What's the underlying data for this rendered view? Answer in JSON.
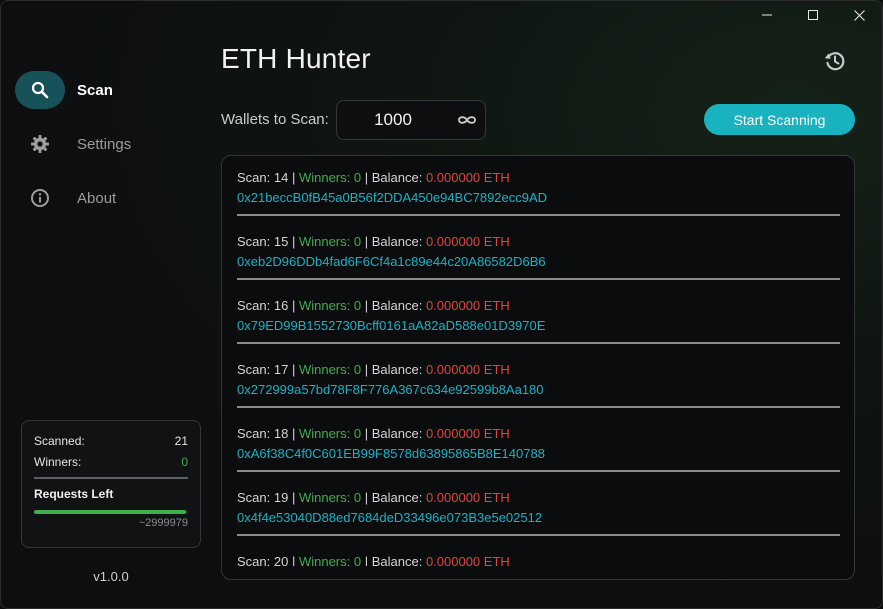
{
  "app": {
    "title": "ETH Hunter",
    "version": "v1.0.0"
  },
  "window_controls": {
    "minimize": "minimize-icon",
    "maximize": "maximize-icon",
    "close": "close-icon"
  },
  "sidebar": {
    "items": [
      {
        "label": "Scan",
        "icon": "search-icon",
        "active": true
      },
      {
        "label": "Settings",
        "icon": "gear-icon",
        "active": false
      },
      {
        "label": "About",
        "icon": "info-icon",
        "active": false
      }
    ]
  },
  "stats": {
    "scanned_label": "Scanned:",
    "scanned_value": "21",
    "winners_label": "Winners:",
    "winners_value": "0",
    "requests_label": "Requests Left",
    "requests_value": "~2999979",
    "requests_fraction": 0.99
  },
  "controls": {
    "wallets_label": "Wallets to Scan:",
    "wallets_value": "1000",
    "infinity_icon": "infinity-icon",
    "start_label": "Start Scanning",
    "history_icon": "history-icon"
  },
  "scans": [
    {
      "scan_label": "Scan:",
      "scan": "14",
      "winners_label": "Winners:",
      "winners": "0",
      "balance_label": "Balance:",
      "balance": "0.000000 ETH",
      "address": "0x21beccB0fB45a0B56f2DDA450e94BC7892ecc9AD"
    },
    {
      "scan_label": "Scan:",
      "scan": "15",
      "winners_label": "Winners:",
      "winners": "0",
      "balance_label": "Balance:",
      "balance": "0.000000 ETH",
      "address": "0xeb2D96DDb4fad6F6Cf4a1c89e44c20A86582D6B6"
    },
    {
      "scan_label": "Scan:",
      "scan": "16",
      "winners_label": "Winners:",
      "winners": "0",
      "balance_label": "Balance:",
      "balance": "0.000000 ETH",
      "address": "0x79ED99B1552730Bcff0161aA82aD588e01D3970E"
    },
    {
      "scan_label": "Scan:",
      "scan": "17",
      "winners_label": "Winners:",
      "winners": "0",
      "balance_label": "Balance:",
      "balance": "0.000000 ETH",
      "address": "0x272999a57bd78F8F776A367c634e92599b8Aa180"
    },
    {
      "scan_label": "Scan:",
      "scan": "18",
      "winners_label": "Winners:",
      "winners": "0",
      "balance_label": "Balance:",
      "balance": "0.000000 ETH",
      "address": "0xA6f38C4f0C601EB99F8578d63895865B8E140788"
    },
    {
      "scan_label": "Scan:",
      "scan": "19",
      "winners_label": "Winners:",
      "winners": "0",
      "balance_label": "Balance:",
      "balance": "0.000000 ETH",
      "address": "0x4f4e53040D88ed7684deD33496e073B3e5e02512"
    },
    {
      "scan_label": "Scan:",
      "scan": "20",
      "winners_label": "Winners:",
      "winners": "0",
      "balance_label": "Balance:",
      "balance": "0.000000 ETH",
      "address": ""
    }
  ],
  "colors": {
    "accent": "#18b3bf",
    "active_nav": "#17525a",
    "success": "#3fae4d",
    "danger": "#e2443e",
    "address": "#1ab1c4"
  }
}
